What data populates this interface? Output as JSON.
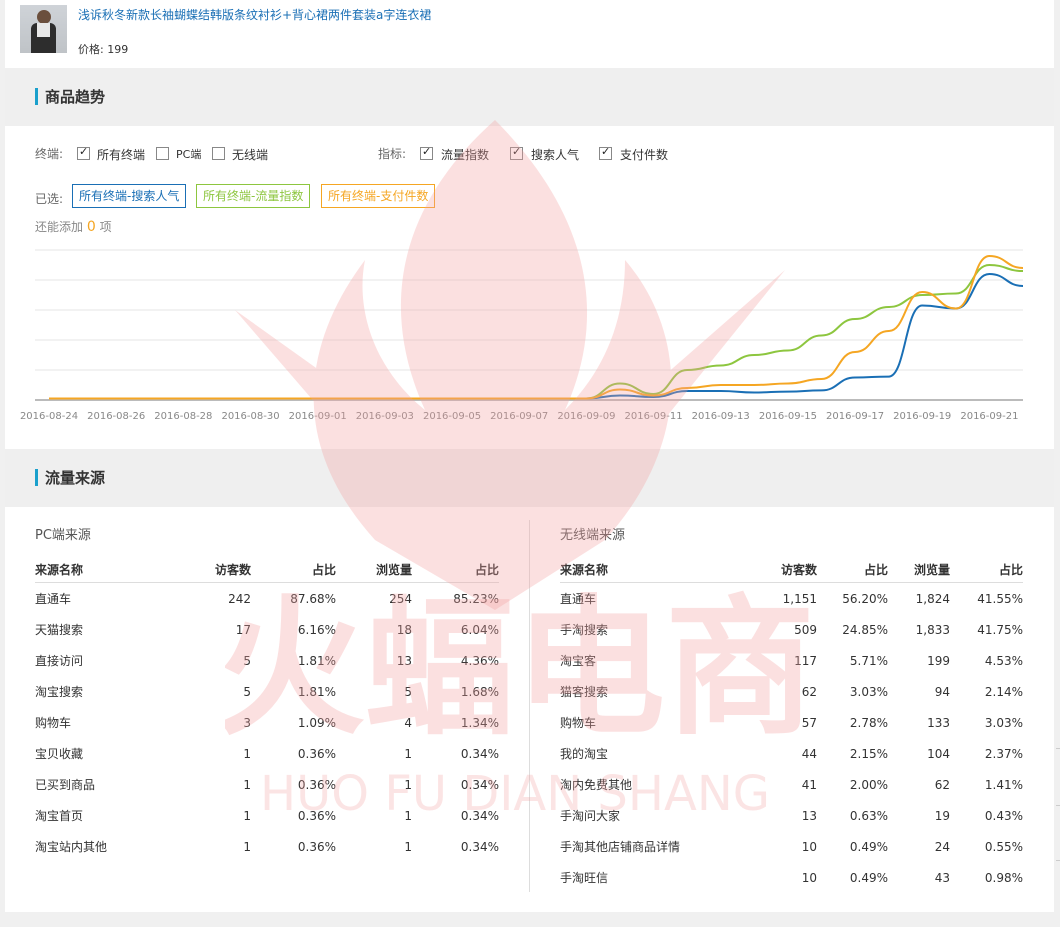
{
  "product": {
    "title": "浅诉秋冬新款长袖蝴蝶结韩版条纹衬衫+背心裙两件套装a字连衣裙",
    "price_label": "价格:",
    "price": "199"
  },
  "trend_section": {
    "title": "商品趋势"
  },
  "filters": {
    "terminal_label": "终端:",
    "terminals": [
      {
        "label": "所有终端",
        "checked": true
      },
      {
        "label": "PC端",
        "checked": false
      },
      {
        "label": "无线端",
        "checked": false
      }
    ],
    "metric_label": "指标:",
    "metrics": [
      {
        "label": "流量指数",
        "checked": true
      },
      {
        "label": "搜索人气",
        "checked": true
      },
      {
        "label": "支付件数",
        "checked": true
      }
    ],
    "selected_label": "已选:",
    "selected_tags": [
      {
        "label": "所有终端-搜索人气",
        "color": "#1a6fb5"
      },
      {
        "label": "所有终端-流量指数",
        "color": "#8dc63f"
      },
      {
        "label": "所有终端-支付件数",
        "color": "#f5a623"
      }
    ],
    "remaining_prefix": "还能添加",
    "remaining_count": "0",
    "remaining_suffix": "项"
  },
  "chart_data": {
    "type": "line",
    "x_tick_labels": [
      "2016-08-24",
      "2016-08-26",
      "2016-08-28",
      "2016-08-30",
      "2016-09-01",
      "2016-09-03",
      "2016-09-05",
      "2016-09-07",
      "2016-09-09",
      "2016-09-11",
      "2016-09-13",
      "2016-09-15",
      "2016-09-17",
      "2016-09-19",
      "2016-09-21"
    ],
    "x": [
      "2016-08-24",
      "2016-08-25",
      "2016-08-26",
      "2016-08-27",
      "2016-08-28",
      "2016-08-29",
      "2016-08-30",
      "2016-08-31",
      "2016-09-01",
      "2016-09-02",
      "2016-09-03",
      "2016-09-04",
      "2016-09-05",
      "2016-09-06",
      "2016-09-07",
      "2016-09-08",
      "2016-09-09",
      "2016-09-10",
      "2016-09-11",
      "2016-09-12",
      "2016-09-13",
      "2016-09-14",
      "2016-09-15",
      "2016-09-16",
      "2016-09-17",
      "2016-09-18",
      "2016-09-19",
      "2016-09-20",
      "2016-09-21",
      "2016-09-22"
    ],
    "grid": true,
    "ylim": [
      0,
      5
    ],
    "series": [
      {
        "name": "所有终端-搜索人气",
        "color": "#1a6fb5",
        "values": [
          0.05,
          0.05,
          0.05,
          0.05,
          0.05,
          0.05,
          0.05,
          0.05,
          0.05,
          0.05,
          0.05,
          0.05,
          0.05,
          0.05,
          0.05,
          0.05,
          0.05,
          0.15,
          0.1,
          0.3,
          0.3,
          0.25,
          0.28,
          0.32,
          0.75,
          0.78,
          3.15,
          3.05,
          4.2,
          3.8
        ]
      },
      {
        "name": "所有终端-流量指数",
        "color": "#8dc63f",
        "values": [
          0.05,
          0.05,
          0.05,
          0.05,
          0.05,
          0.05,
          0.05,
          0.05,
          0.05,
          0.05,
          0.05,
          0.05,
          0.05,
          0.05,
          0.05,
          0.05,
          0.05,
          0.55,
          0.2,
          1.0,
          1.15,
          1.5,
          1.65,
          2.15,
          2.7,
          3.1,
          3.5,
          3.55,
          4.5,
          4.3
        ]
      },
      {
        "name": "所有终端-支付件数",
        "color": "#f5a623",
        "values": [
          0.05,
          0.05,
          0.05,
          0.05,
          0.05,
          0.05,
          0.05,
          0.05,
          0.05,
          0.05,
          0.05,
          0.05,
          0.05,
          0.05,
          0.05,
          0.05,
          0.05,
          0.35,
          0.15,
          0.4,
          0.5,
          0.5,
          0.55,
          0.7,
          1.6,
          2.3,
          3.6,
          3.05,
          4.8,
          4.4
        ]
      }
    ]
  },
  "traffic_section": {
    "title": "流量来源"
  },
  "pc_sources": {
    "title": "PC端来源",
    "headers": [
      "来源名称",
      "访客数",
      "占比",
      "浏览量",
      "占比"
    ],
    "rows": [
      [
        "直通车",
        "242",
        "87.68%",
        "254",
        "85.23%"
      ],
      [
        "天猫搜索",
        "17",
        "6.16%",
        "18",
        "6.04%"
      ],
      [
        "直接访问",
        "5",
        "1.81%",
        "13",
        "4.36%"
      ],
      [
        "淘宝搜索",
        "5",
        "1.81%",
        "5",
        "1.68%"
      ],
      [
        "购物车",
        "3",
        "1.09%",
        "4",
        "1.34%"
      ],
      [
        "宝贝收藏",
        "1",
        "0.36%",
        "1",
        "0.34%"
      ],
      [
        "已买到商品",
        "1",
        "0.36%",
        "1",
        "0.34%"
      ],
      [
        "淘宝首页",
        "1",
        "0.36%",
        "1",
        "0.34%"
      ],
      [
        "淘宝站内其他",
        "1",
        "0.36%",
        "1",
        "0.34%"
      ]
    ]
  },
  "wireless_sources": {
    "title": "无线端来源",
    "headers": [
      "来源名称",
      "访客数",
      "占比",
      "浏览量",
      "占比"
    ],
    "rows": [
      [
        "直通车",
        "1,151",
        "56.20%",
        "1,824",
        "41.55%"
      ],
      [
        "手淘搜索",
        "509",
        "24.85%",
        "1,833",
        "41.75%"
      ],
      [
        "淘宝客",
        "117",
        "5.71%",
        "199",
        "4.53%"
      ],
      [
        "猫客搜索",
        "62",
        "3.03%",
        "94",
        "2.14%"
      ],
      [
        "购物车",
        "57",
        "2.78%",
        "133",
        "3.03%"
      ],
      [
        "我的淘宝",
        "44",
        "2.15%",
        "104",
        "2.37%"
      ],
      [
        "淘内免费其他",
        "41",
        "2.00%",
        "62",
        "1.41%"
      ],
      [
        "手淘问大家",
        "13",
        "0.63%",
        "19",
        "0.43%"
      ],
      [
        "手淘其他店铺商品详情",
        "10",
        "0.49%",
        "24",
        "0.55%"
      ],
      [
        "手淘旺信",
        "10",
        "0.49%",
        "43",
        "0.98%"
      ]
    ]
  },
  "watermark": {
    "text_cn": "火蝠电商",
    "text_en": "HUO FU DIAN SHANG",
    "color": "#f4a0a0"
  }
}
